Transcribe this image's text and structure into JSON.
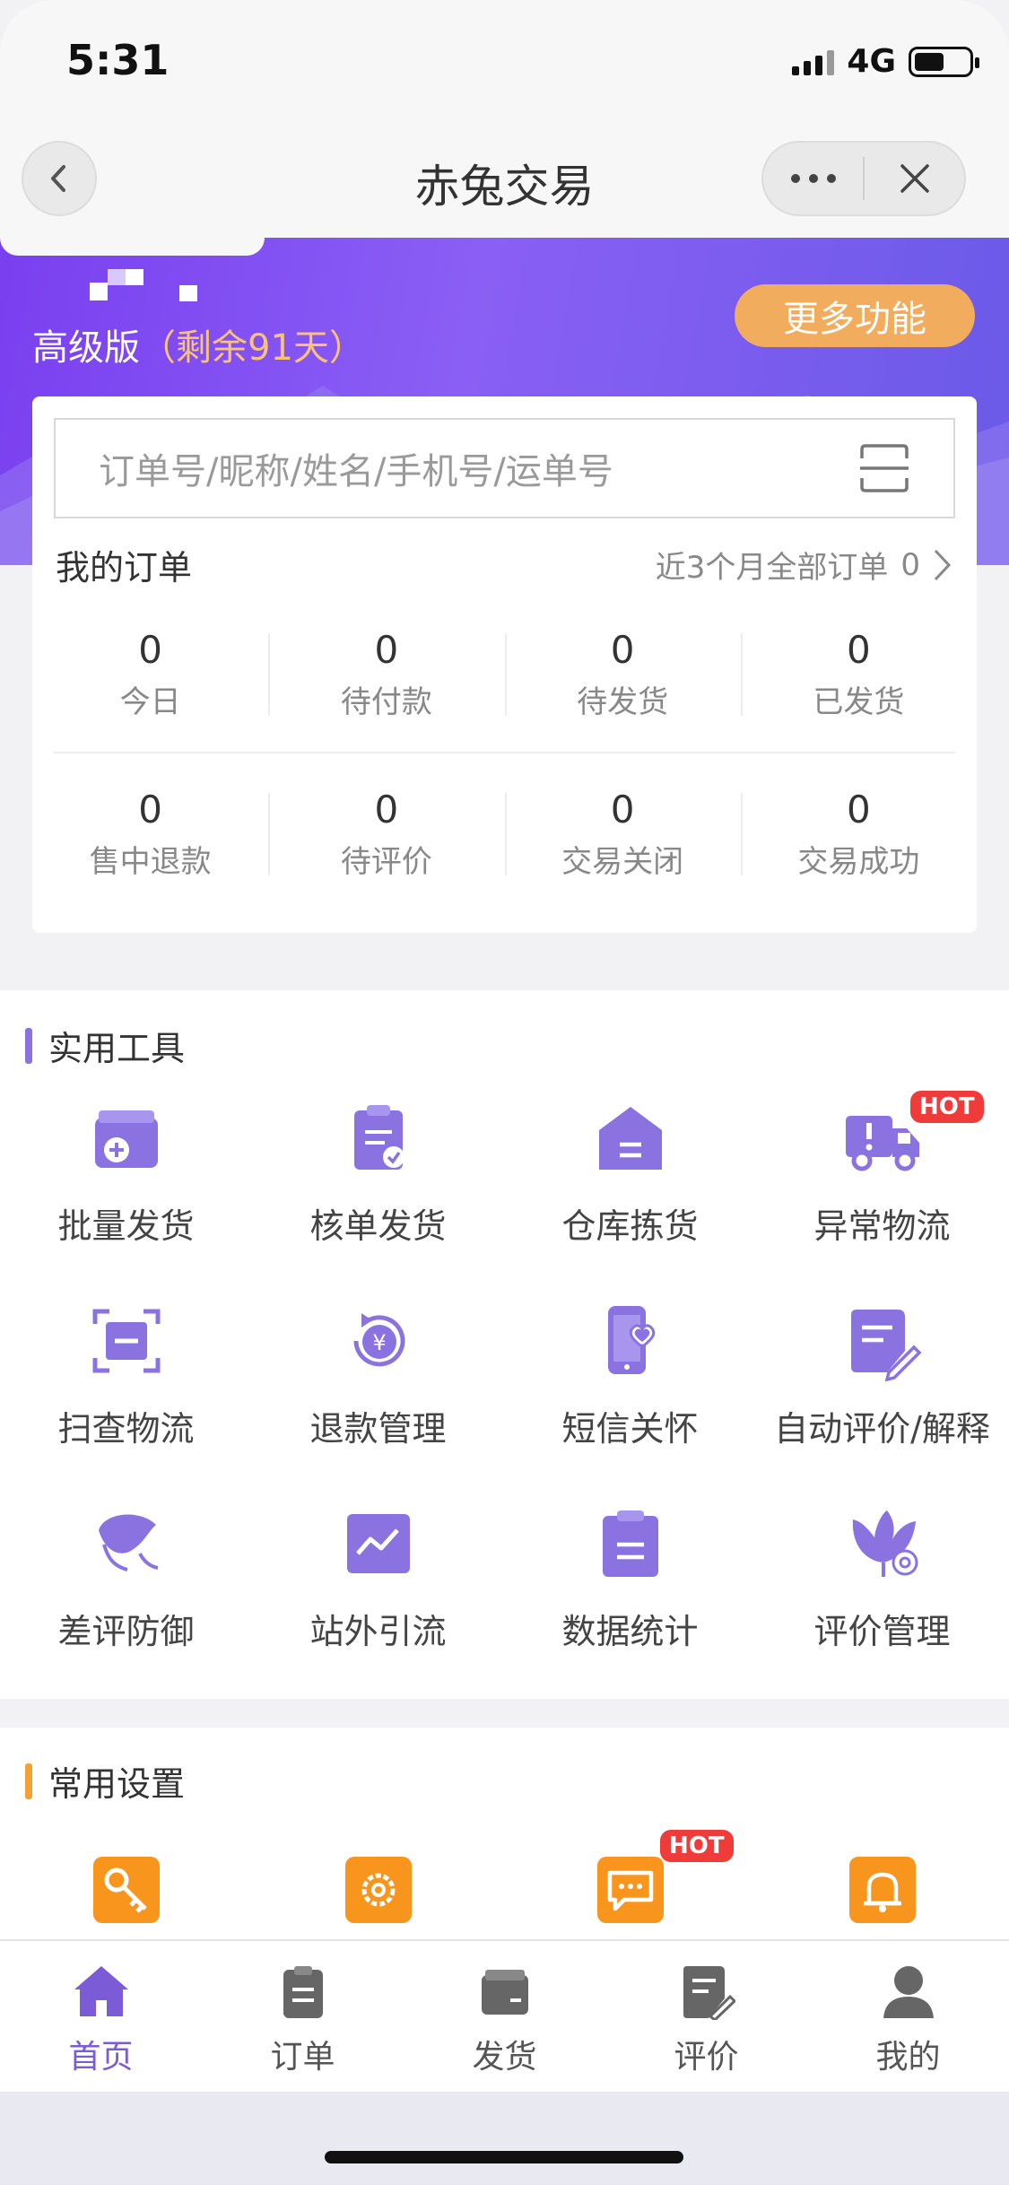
{
  "status_bar": {
    "time": "5:31",
    "network": "4G",
    "battery_level": 0.55
  },
  "navbar": {
    "title": "赤兔交易",
    "more_icon": "more-dots-icon",
    "close_icon": "close-icon",
    "back_icon": "back-icon"
  },
  "banner": {
    "edition": "高级版",
    "remaining": "（剩余91天）",
    "more_button": "更多功能"
  },
  "search": {
    "placeholder": "订单号/昵称/姓名/手机号/运单号",
    "scan_icon": "scan-icon"
  },
  "orders": {
    "title": "我的订单",
    "all_label": "近3个月全部订单",
    "all_count": "0",
    "row1": [
      {
        "num": "0",
        "label": "今日"
      },
      {
        "num": "0",
        "label": "待付款"
      },
      {
        "num": "0",
        "label": "待发货"
      },
      {
        "num": "0",
        "label": "已发货"
      }
    ],
    "row2": [
      {
        "num": "0",
        "label": "售中退款"
      },
      {
        "num": "0",
        "label": "待评价"
      },
      {
        "num": "0",
        "label": "交易关闭"
      },
      {
        "num": "0",
        "label": "交易成功"
      }
    ]
  },
  "tools": {
    "title": "实用工具",
    "accent": "#8a73e0",
    "items": [
      {
        "label": "批量发货",
        "icon": "box-add-icon"
      },
      {
        "label": "核单发货",
        "icon": "clipboard-check-icon"
      },
      {
        "label": "仓库拣货",
        "icon": "warehouse-icon"
      },
      {
        "label": "异常物流",
        "icon": "truck-alert-icon",
        "badge": "HOT"
      },
      {
        "label": "扫查物流",
        "icon": "scan-frame-icon"
      },
      {
        "label": "退款管理",
        "icon": "refund-yen-icon"
      },
      {
        "label": "短信关怀",
        "icon": "phone-heart-icon"
      },
      {
        "label": "自动评价/解释",
        "icon": "note-edit-icon"
      },
      {
        "label": "差评防御",
        "icon": "shield-leaf-icon"
      },
      {
        "label": "站外引流",
        "icon": "trend-chart-icon"
      },
      {
        "label": "数据统计",
        "icon": "clipboard-list-icon"
      },
      {
        "label": "评价管理",
        "icon": "flower-gear-icon"
      }
    ]
  },
  "settings": {
    "title": "常用设置",
    "accent": "#f5a033",
    "items": [
      {
        "icon": "key-icon"
      },
      {
        "icon": "gear-icon"
      },
      {
        "icon": "message-icon",
        "badge": "HOT"
      },
      {
        "icon": "bell-icon"
      }
    ]
  },
  "tabbar": {
    "items": [
      {
        "label": "首页",
        "icon": "home-icon",
        "active": true
      },
      {
        "label": "订单",
        "icon": "order-icon"
      },
      {
        "label": "发货",
        "icon": "ship-box-icon"
      },
      {
        "label": "评价",
        "icon": "review-icon"
      },
      {
        "label": "我的",
        "icon": "user-icon"
      }
    ]
  }
}
